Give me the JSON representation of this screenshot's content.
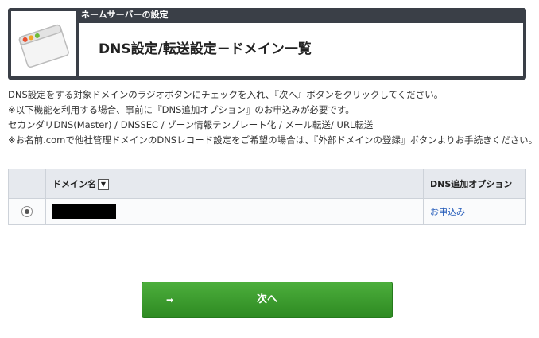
{
  "header": {
    "subtitle": "ネームサーバーの設定",
    "title": "DNS設定/転送設定－ドメイン一覧",
    "icon": "browser-window-icon"
  },
  "description": [
    "DNS設定をする対象ドメインのラジオボタンにチェックを入れ、『次へ』ボタンをクリックしてください。",
    "※以下機能を利用する場合、事前に『DNS追加オプション』のお申込みが必要です。",
    "セカンダリDNS(Master) / DNSSEC / ゾーン情報テンプレート化 / メール転送/ URL転送",
    "※お名前.comで他社管理ドメインのDNSレコード設定をご希望の場合は、『外部ドメインの登録』ボタンよりお手続きください。"
  ],
  "table": {
    "columns": [
      "",
      "ドメイン名",
      "DNS追加オプション"
    ],
    "sort_icon": "▼",
    "rows": [
      {
        "selected": true,
        "domain": "",
        "option_link": "お申込み"
      }
    ]
  },
  "next_button": {
    "label": "次へ",
    "icon": "arrow-right-icon"
  }
}
